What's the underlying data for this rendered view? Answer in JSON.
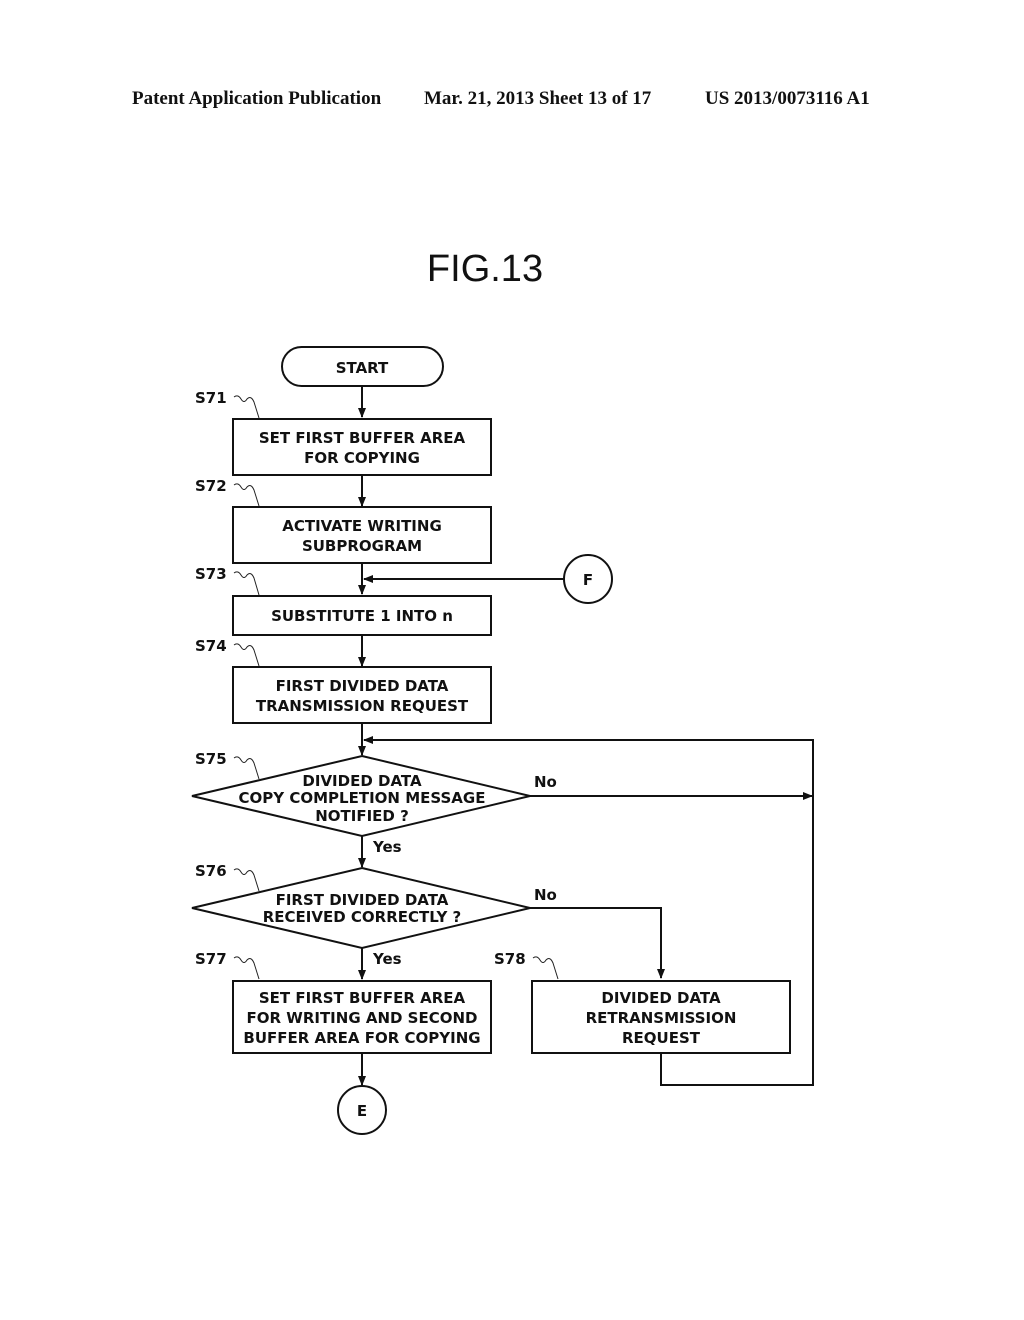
{
  "header": {
    "left": "Patent Application Publication",
    "middle": "Mar. 21, 2013  Sheet 13 of 17",
    "right": "US 2013/0073116 A1"
  },
  "figure": {
    "title": "FIG.13"
  },
  "flowchart": {
    "start": "START",
    "steps": {
      "s71": {
        "id": "S71",
        "lines": [
          "SET FIRST BUFFER AREA",
          "FOR COPYING"
        ]
      },
      "s72": {
        "id": "S72",
        "lines": [
          "ACTIVATE WRITING",
          "SUBPROGRAM"
        ]
      },
      "s73": {
        "id": "S73",
        "lines": [
          "SUBSTITUTE 1 INTO n"
        ]
      },
      "s74": {
        "id": "S74",
        "lines": [
          "FIRST DIVIDED DATA",
          "TRANSMISSION REQUEST"
        ]
      },
      "s75": {
        "id": "S75",
        "lines": [
          "DIVIDED DATA",
          "COPY COMPLETION MESSAGE",
          "NOTIFIED ?"
        ]
      },
      "s76": {
        "id": "S76",
        "lines": [
          "FIRST DIVIDED DATA",
          "RECEIVED CORRECTLY ?"
        ]
      },
      "s77": {
        "id": "S77",
        "lines": [
          "SET FIRST BUFFER AREA",
          "FOR WRITING AND SECOND",
          "BUFFER AREA FOR COPYING"
        ]
      },
      "s78": {
        "id": "S78",
        "lines": [
          "DIVIDED DATA",
          "RETRANSMISSION",
          "REQUEST"
        ]
      }
    },
    "branches": {
      "s75_yes": "Yes",
      "s75_no": "No",
      "s76_yes": "Yes",
      "s76_no": "No"
    },
    "connectors": {
      "f": "F",
      "e": "E"
    }
  }
}
